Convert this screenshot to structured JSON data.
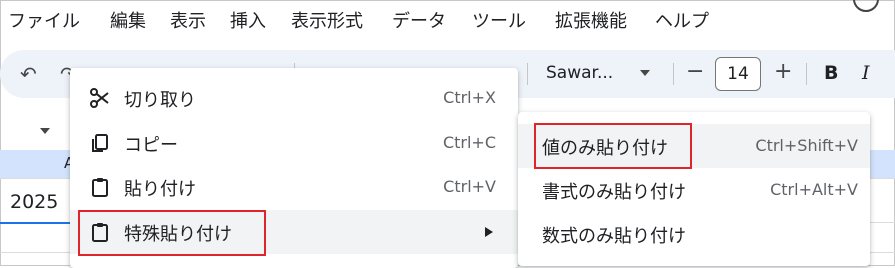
{
  "menubar": {
    "items": [
      "ファイル",
      "編集",
      "表示",
      "挿入",
      "表示形式",
      "データ",
      "ツール",
      "拡張機能",
      "ヘルプ"
    ]
  },
  "toolbar": {
    "font_name": "Sawar...",
    "font_size": "14",
    "decrease_label": "−",
    "increase_label": "+",
    "bold_label": "B",
    "italic_label": "I"
  },
  "sheet": {
    "column_letter": "A",
    "cell_value": "2025"
  },
  "context_menu": {
    "items": [
      {
        "label": "切り取り",
        "shortcut": "Ctrl+X",
        "icon": "scissors-icon"
      },
      {
        "label": "コピー",
        "shortcut": "Ctrl+C",
        "icon": "copy-icon"
      },
      {
        "label": "貼り付け",
        "shortcut": "Ctrl+V",
        "icon": "clipboard-icon"
      },
      {
        "label": "特殊貼り付け",
        "shortcut": "",
        "icon": "clipboard-icon"
      }
    ]
  },
  "submenu": {
    "items": [
      {
        "label": "値のみ貼り付け",
        "shortcut": "Ctrl+Shift+V"
      },
      {
        "label": "書式のみ貼り付け",
        "shortcut": "Ctrl+Alt+V"
      },
      {
        "label": "数式のみ貼り付け",
        "shortcut": ""
      }
    ]
  },
  "colors": {
    "highlight_border": "#e0242b",
    "selection_blue": "#1a73e8",
    "column_header_bg": "#d3e3fd"
  }
}
